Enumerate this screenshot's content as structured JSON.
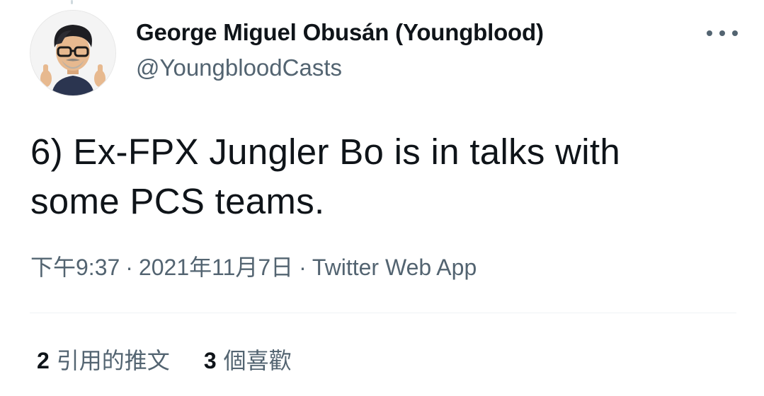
{
  "tweet": {
    "author": {
      "display_name": "George Miguel Obusán (Youngblood)",
      "handle": "@YoungbloodCasts",
      "avatar_icon": "memoji-avatar"
    },
    "text_lines": [
      "6) Ex-FPX Jungler Bo is in talks with",
      "some PCS teams."
    ],
    "time": "下午9:37",
    "date": "2021年11月7日",
    "source": "Twitter Web App",
    "separator": "·",
    "more_icon": "more-horizontal-icon"
  },
  "stats": {
    "quotes": {
      "count": "2",
      "label": "引用的推文"
    },
    "likes": {
      "count": "3",
      "label": "個喜歡"
    }
  },
  "colors": {
    "text_primary": "#0f1419",
    "text_secondary": "#536471",
    "divider": "#eff3f4"
  }
}
